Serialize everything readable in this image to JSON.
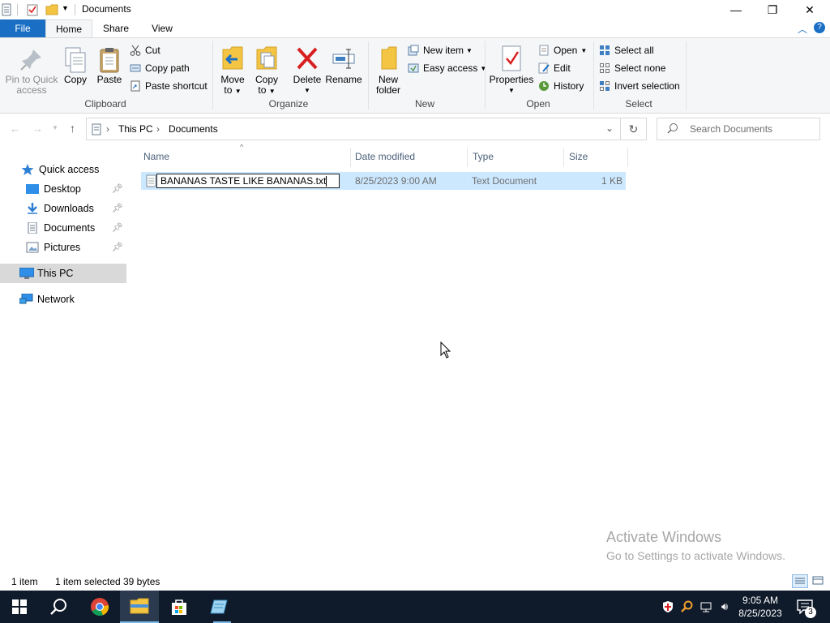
{
  "titlebar": {
    "title": "Documents",
    "minimize": "—",
    "restore": "❐",
    "close": "✕"
  },
  "ribbon_tabs": {
    "file": "File",
    "home": "Home",
    "share": "Share",
    "view": "View"
  },
  "clipboard": {
    "pin_label_1": "Pin to Quick",
    "pin_label_2": "access",
    "copy": "Copy",
    "paste": "Paste",
    "cut": "Cut",
    "copy_path": "Copy path",
    "paste_shortcut": "Paste shortcut",
    "group": "Clipboard"
  },
  "organize": {
    "move_1": "Move",
    "move_2": "to",
    "copy_1": "Copy",
    "copy_2": "to",
    "delete": "Delete",
    "rename": "Rename",
    "group": "Organize"
  },
  "new": {
    "new_folder_1": "New",
    "new_folder_2": "folder",
    "new_item": "New item",
    "easy_access": "Easy access",
    "group": "New"
  },
  "open": {
    "properties": "Properties",
    "open": "Open",
    "edit": "Edit",
    "history": "History",
    "group": "Open"
  },
  "select": {
    "select_all": "Select all",
    "select_none": "Select none",
    "invert": "Invert selection",
    "group": "Select"
  },
  "address": {
    "crumb_1": "This PC",
    "crumb_2": "Documents",
    "search_placeholder": "Search Documents"
  },
  "nav": {
    "quick_access": "Quick access",
    "desktop": "Desktop",
    "downloads": "Downloads",
    "documents": "Documents",
    "pictures": "Pictures",
    "this_pc": "This PC",
    "network": "Network"
  },
  "columns": {
    "name": "Name",
    "date": "Date modified",
    "type": "Type",
    "size": "Size"
  },
  "files": [
    {
      "name": "BANANAS TASTE LIKE BANANAS.txt",
      "date": "8/25/2023 9:00 AM",
      "type": "Text Document",
      "size": "1 KB"
    }
  ],
  "status": {
    "count": "1 item",
    "selected": "1 item selected",
    "bytes": "39 bytes"
  },
  "watermark": {
    "line1": "Activate Windows",
    "line2": "Go to Settings to activate Windows."
  },
  "taskbar": {
    "time": "9:05 AM",
    "date": "8/25/2023",
    "notifications": "3"
  },
  "colors": {
    "accent": "#1a6fc4",
    "selection": "#cce8ff",
    "taskbar": "#0f1a2a",
    "delete_red": "#d82020",
    "folder_yellow": "#f4c542"
  }
}
